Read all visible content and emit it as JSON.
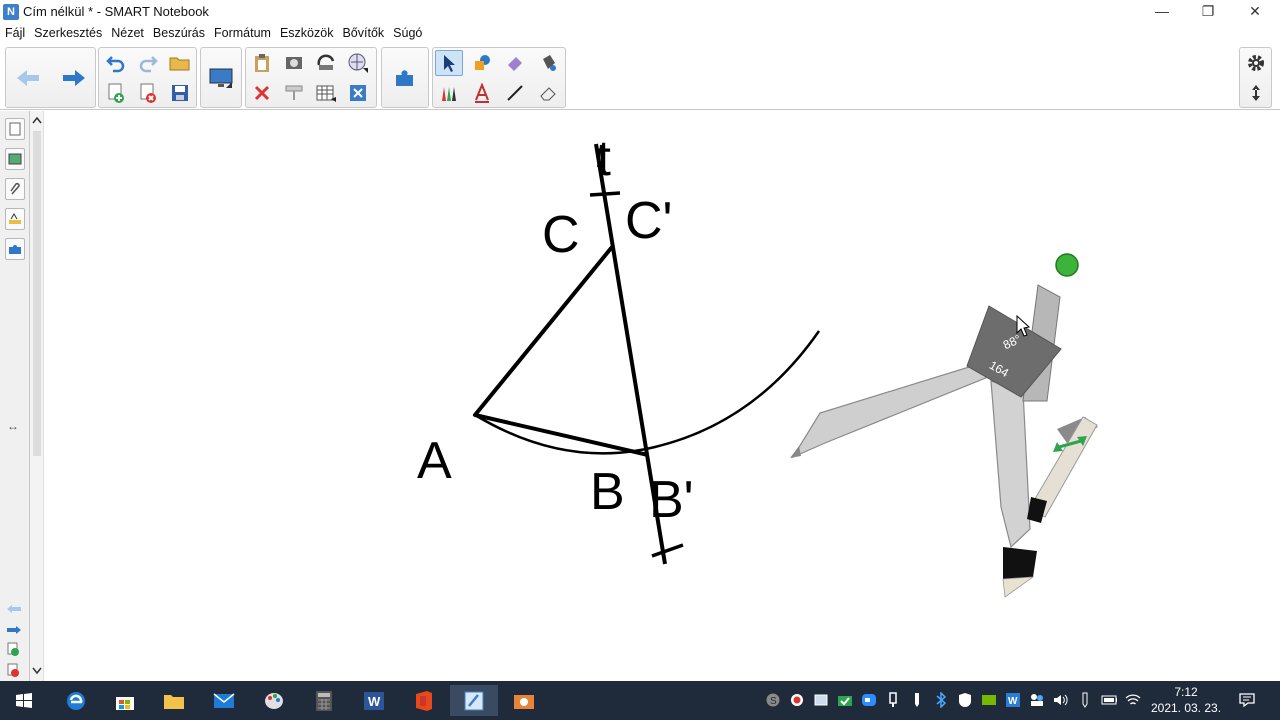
{
  "window": {
    "title": "Cím nélkül * - SMART Notebook",
    "app_icon": "notebook-icon",
    "controls": {
      "minimize": "—",
      "restore": "❐",
      "close": "✕"
    }
  },
  "menu": [
    "Fájl",
    "Szerkesztés",
    "Nézet",
    "Beszúrás",
    "Formátum",
    "Eszközök",
    "Bővítők",
    "Súgó"
  ],
  "toolbar": {
    "nav": [
      "back-arrow-icon",
      "forward-arrow-icon"
    ],
    "edit_row1": [
      "undo-icon",
      "redo-icon",
      "open-folder-icon"
    ],
    "edit_row2": [
      "add-page-icon",
      "delete-page-icon",
      "save-icon"
    ],
    "display": [
      "screen-shade-icon"
    ],
    "content_row1": [
      "paste-icon",
      "screen-capture-icon",
      "show-hide-icon",
      "document-camera-icon"
    ],
    "content_row2": [
      "delete-icon",
      "screen-shade-icon",
      "insert-table-icon",
      "full-screen-icon"
    ],
    "addons": [
      "addon-puzzle-icon"
    ],
    "tools_row1": [
      "select-icon",
      "shapes-icon",
      "eraser-icon",
      "fill-icon"
    ],
    "tools_row2": [
      "pens-icon",
      "text-icon",
      "line-icon",
      "eraser-tool-icon"
    ],
    "right": [
      "settings-gear-icon",
      "move-toolbar-icon"
    ]
  },
  "sidebar": {
    "tabs": [
      "page-sorter-icon",
      "gallery-icon",
      "attachments-icon",
      "properties-icon",
      "addons-icon"
    ],
    "bottom": [
      "back-arrow-icon",
      "forward-arrow-icon",
      "add-page-icon",
      "delete-page-icon"
    ],
    "resize_handle": "↔"
  },
  "canvas": {
    "labels": {
      "t": "t",
      "c": "C",
      "c_prime": "C'",
      "a": "A",
      "b": "B",
      "b_prime": "B'"
    },
    "compass": {
      "angle": "88°",
      "radius": "164"
    }
  },
  "taskbar": {
    "apps": [
      "windows-start-icon",
      "edge-icon",
      "store-icon",
      "file-explorer-icon",
      "mail-icon",
      "paint3d-icon",
      "calculator-icon",
      "word-icon",
      "office-icon",
      "smart-notebook-icon",
      "camera-icon"
    ],
    "tray": [
      "skype-icon",
      "record-icon",
      "snip-icon",
      "security-icon",
      "zoom-icon",
      "usb-icon",
      "bluetooth-icon",
      "shield-icon",
      "nvidia-icon",
      "word-icon",
      "people-icon",
      "volume-icon",
      "pen-icon",
      "battery-icon",
      "wifi-icon"
    ],
    "time": "7:12",
    "date": "2021. 03. 23.",
    "notification_icon": "notification-icon"
  }
}
